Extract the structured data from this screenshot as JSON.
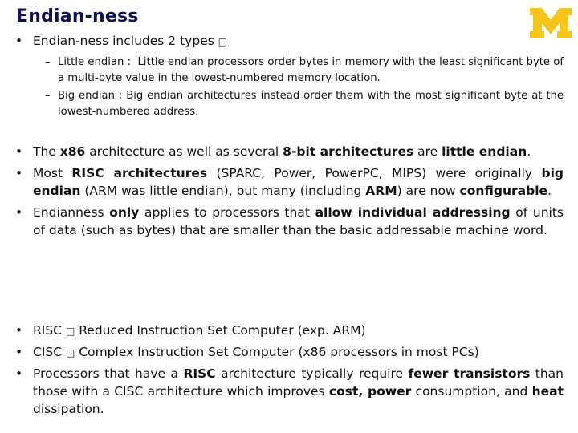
{
  "slide": {
    "title": "Endian-ness",
    "logo": "university-of-michigan-block-m",
    "accent_color": "#0f0f55",
    "logo_color": "#f5c518",
    "intro": {
      "text": "Endian-ness includes 2 types",
      "glyph": "□"
    },
    "types": [
      {
        "name": "Little endian :",
        "description": "Little endian processors order bytes in memory with the least significant byte of a multi-byte value in the lowest-numbered memory location."
      },
      {
        "name": "Big endian :",
        "description": "Big endian architectures instead order them with the most significant byte at the lowest-numbered address."
      }
    ],
    "points": [
      {
        "p1": "The ",
        "b1": "x86",
        "p2": " architecture as well as several ",
        "b2": "8-bit architectures",
        "p3": " are ",
        "b3": "little endian",
        "p4": "."
      },
      {
        "p1": "Most ",
        "b1": "RISC architectures",
        "p2": " (SPARC, Power, PowerPC, MIPS) were originally ",
        "b2": "big endian",
        "p3": " (ARM was little endian), but many (including ",
        "b3": "ARM",
        "p4": ") are now ",
        "b4": "configurable",
        "p5": "."
      },
      {
        "p1": "Endianness ",
        "b1": "only",
        "p2": " applies to processors that ",
        "b2": "allow individual addressing",
        "p3": " of units of data (such as bytes) that are smaller than the basic addressable machine word."
      }
    ],
    "definitions": [
      {
        "term": "RISC",
        "glyph": "□",
        "definition": "Reduced Instruction Set Computer (exp. ARM)"
      },
      {
        "term": "CISC",
        "glyph": "□",
        "definition": "Complex Instruction Set Computer (x86 processors in most PCs)"
      }
    ],
    "conclusion": {
      "p1": "Processors that have a ",
      "b1": "RISC",
      "p2": " architecture typically require ",
      "b2": "fewer transistors",
      "p3": " than those with a CISC architecture which improves ",
      "b3": "cost, power",
      "p4": " consumption, and ",
      "b4": "heat",
      "p5": " dissipation."
    }
  }
}
